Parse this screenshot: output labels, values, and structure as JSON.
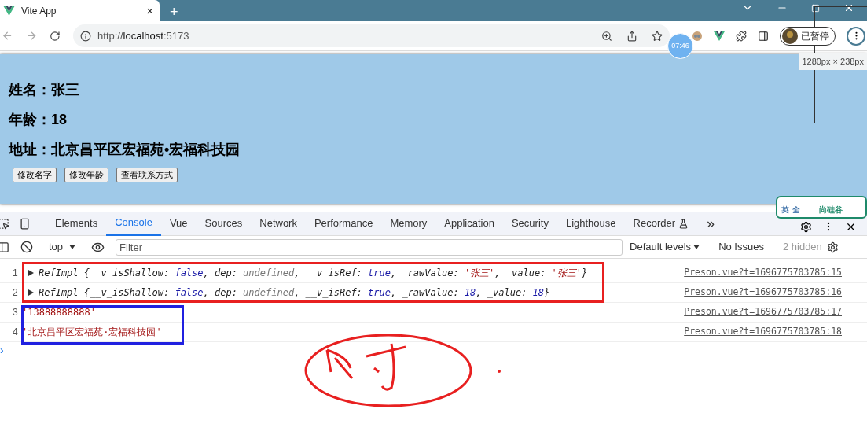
{
  "browser_tab": {
    "title": "Vite App",
    "close": "×",
    "new_tab": "+"
  },
  "address_bar": {
    "url_prefix": "http://",
    "url_host": "localhost",
    "url_port": ":5173"
  },
  "profile": {
    "label": "已暂停"
  },
  "clock_widget": {
    "time": "07:46"
  },
  "size_tooltip": "1280px × 238px",
  "page": {
    "fields": [
      {
        "label": "姓名：",
        "value": "张三"
      },
      {
        "label": "年龄：",
        "value": "18"
      },
      {
        "label": "地址：",
        "value": "北京昌平区宏福苑•宏福科技园"
      }
    ],
    "buttons": [
      "修改名字",
      "修改年龄",
      "查看联系方式"
    ]
  },
  "ime_widget": {
    "mode": "英",
    "width": "全",
    "brand": "尚硅谷"
  },
  "devtools": {
    "tabs": [
      {
        "label": "Elements",
        "selected": false
      },
      {
        "label": "Console",
        "selected": true
      },
      {
        "label": "Vue",
        "selected": false
      },
      {
        "label": "Sources",
        "selected": false
      },
      {
        "label": "Network",
        "selected": false
      },
      {
        "label": "Performance",
        "selected": false
      },
      {
        "label": "Memory",
        "selected": false
      },
      {
        "label": "Application",
        "selected": false
      },
      {
        "label": "Security",
        "selected": false
      },
      {
        "label": "Lighthouse",
        "selected": false
      },
      {
        "label": "Recorder",
        "selected": false
      }
    ],
    "more_tabs": "»",
    "context": "top",
    "filter_placeholder": "Filter",
    "levels": "Default levels",
    "issues": "No Issues",
    "hidden": "2 hidden",
    "messages": [
      {
        "line": "1",
        "kind": "object",
        "source": "Preson.vue?t=1696775703785:15",
        "segments": [
          {
            "text": "RefImpl {",
            "kind": "plain"
          },
          {
            "text": "__v_isShallow: ",
            "kind": "plain"
          },
          {
            "text": "false",
            "kind": "keyword"
          },
          {
            "text": ", dep: ",
            "kind": "plain"
          },
          {
            "text": "undefined",
            "kind": "muted"
          },
          {
            "text": ", __v_isRef: ",
            "kind": "plain"
          },
          {
            "text": "true",
            "kind": "keyword"
          },
          {
            "text": ", _rawValue: ",
            "kind": "plain"
          },
          {
            "text": "'张三'",
            "kind": "string"
          },
          {
            "text": ", _value: ",
            "kind": "plain"
          },
          {
            "text": "'张三'",
            "kind": "string"
          },
          {
            "text": "}",
            "kind": "plain"
          }
        ]
      },
      {
        "line": "2",
        "kind": "object",
        "source": "Preson.vue?t=1696775703785:16",
        "segments": [
          {
            "text": "RefImpl {",
            "kind": "plain"
          },
          {
            "text": "__v_isShallow: ",
            "kind": "plain"
          },
          {
            "text": "false",
            "kind": "keyword"
          },
          {
            "text": ", dep: ",
            "kind": "plain"
          },
          {
            "text": "undefined",
            "kind": "muted"
          },
          {
            "text": ", __v_isRef: ",
            "kind": "plain"
          },
          {
            "text": "true",
            "kind": "keyword"
          },
          {
            "text": ", _rawValue: ",
            "kind": "plain"
          },
          {
            "text": "18",
            "kind": "keyword"
          },
          {
            "text": ", _value: ",
            "kind": "plain"
          },
          {
            "text": "18",
            "kind": "keyword"
          },
          {
            "text": "}",
            "kind": "plain"
          }
        ]
      },
      {
        "line": "3",
        "kind": "string",
        "source": "Preson.vue?t=1696775703785:17",
        "segments": [
          {
            "text": "'13888888888'",
            "kind": "string"
          }
        ]
      },
      {
        "line": "4",
        "kind": "string",
        "source": "Preson.vue?t=1696775703785:18",
        "segments": [
          {
            "text": "'北京昌平区宏福苑·宏福科技园'",
            "kind": "string"
          }
        ]
      }
    ],
    "prompt": "›"
  }
}
